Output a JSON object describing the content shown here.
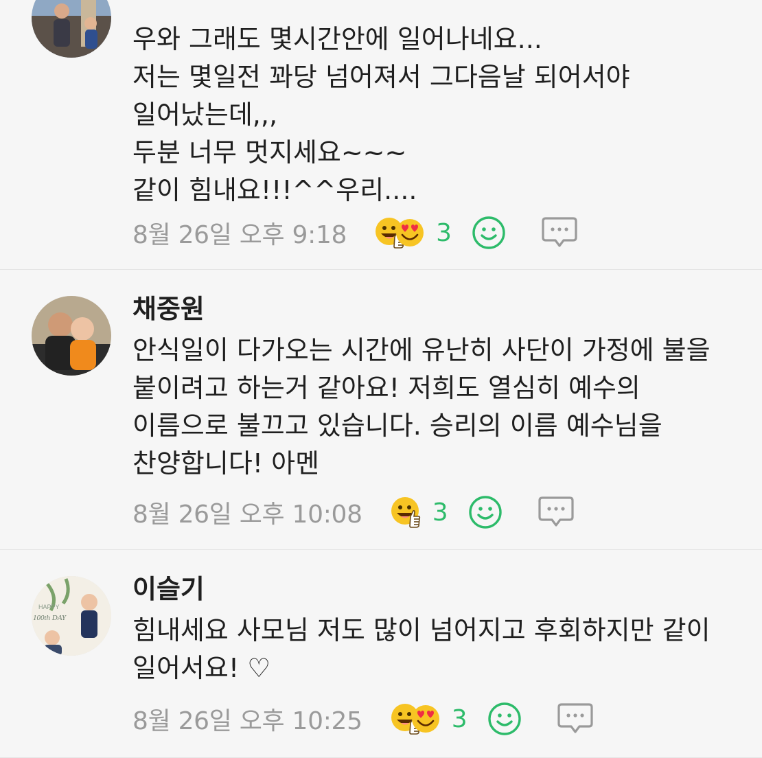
{
  "comments": [
    {
      "author": "",
      "text": "우와 그래도 몇시간안에 일어나네요...\n저는 몇일전 꽈당 넘어져서 그다음날 되어서야 일어났는데,,,\n두분 너무 멋지세요~~~\n같이 힘내요!!!^^우리....",
      "time": "8월 26일 오후 9:18",
      "reaction_count": "3",
      "reactions": [
        "thumbs-smile-emoji",
        "heart-eyes-emoji"
      ]
    },
    {
      "author": "채중원",
      "text": "안식일이 다가오는 시간에 유난히 사단이 가정에 불을 붙이려고 하는거 같아요! 저희도 열심히 예수의 이름으로 불끄고 있습니다. 승리의 이름 예수님을 찬양합니다! 아멘",
      "time": "8월 26일 오후 10:08",
      "reaction_count": "3",
      "reactions": [
        "thumbs-smile-emoji"
      ]
    },
    {
      "author": "이슬기",
      "text": "힘내세요 사모님 저도 많이 넘어지고 후회하지만 같이 일어서요! ♡",
      "time": "8월 26일 오후 10:25",
      "reaction_count": "3",
      "reactions": [
        "thumbs-smile-emoji",
        "heart-eyes-emoji"
      ]
    }
  ],
  "avatar_text": {
    "happy": "HAPPY",
    "hundred_day": "100th DAY"
  },
  "colors": {
    "background": "#f6f6f6",
    "text": "#1f1f1f",
    "timestamp": "#9a9a9a",
    "accent_green": "#2dbb6a",
    "divider": "#e5e5e5",
    "emoji_yellow": "#f7c423"
  },
  "icons": {
    "add_reaction": "smile-outline-icon",
    "reply": "speech-bubble-icon"
  }
}
